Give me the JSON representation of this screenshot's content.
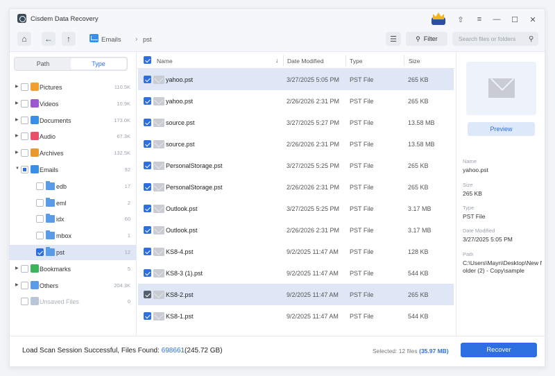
{
  "app": {
    "title": "Cisdem Data Recovery"
  },
  "colors": {
    "accent": "#2d6fe0",
    "selected_row": "#dfe7f7",
    "folder": "#5a9be8"
  },
  "titlebar": {
    "icons": [
      {
        "name": "upgrade-crown-icon"
      },
      {
        "name": "export-icon",
        "glyph": "⇧"
      },
      {
        "name": "menu-icon",
        "glyph": "≡"
      },
      {
        "name": "minimize-icon",
        "glyph": "—"
      },
      {
        "name": "maximize-icon",
        "glyph": "☐"
      },
      {
        "name": "close-icon",
        "glyph": "✕"
      }
    ]
  },
  "toolbar": {
    "home_glyph": "⌂",
    "back_glyph": "←",
    "up_glyph": "↑",
    "breadcrumb": [
      "Emails",
      "pst"
    ],
    "breadcrumb_sep": "›",
    "view_glyph": "☰",
    "filter_label": "Filter",
    "filter_glyph": "⚲",
    "search_placeholder": "Search files or folders",
    "search_glyph": "⚲"
  },
  "sidebar": {
    "tabs": [
      "Path",
      "Type"
    ],
    "active_tab": "Type",
    "items": [
      {
        "label": "Pictures",
        "count": "110.5K",
        "icon_color": "#f0a030",
        "expandable": true
      },
      {
        "label": "Videos",
        "count": "10.9K",
        "icon_color": "#9b59d0",
        "expandable": true
      },
      {
        "label": "Documents",
        "count": "173.0K",
        "icon_color": "#3a8ee6",
        "expandable": true
      },
      {
        "label": "Audio",
        "count": "67.3K",
        "icon_color": "#e8506a",
        "expandable": true
      },
      {
        "label": "Archives",
        "count": "132.5K",
        "icon_color": "#e89a30",
        "expandable": true
      },
      {
        "label": "Emails",
        "count": "92",
        "icon_color": "#3a8ee6",
        "expandable": true,
        "expanded": true
      },
      {
        "label": "edb",
        "count": "17",
        "folder": true
      },
      {
        "label": "eml",
        "count": "2",
        "folder": true
      },
      {
        "label": "idx",
        "count": "60",
        "folder": true
      },
      {
        "label": "mbox",
        "count": "1",
        "folder": true
      },
      {
        "label": "pst",
        "count": "12",
        "folder": true,
        "selected": true
      },
      {
        "label": "Bookmarks",
        "count": "5",
        "icon_color": "#3cb55a",
        "expandable": true
      },
      {
        "label": "Others",
        "count": "204.3K",
        "icon_color": "#5a9be8",
        "expandable": true
      },
      {
        "label": "Unsaved Files",
        "count": "0",
        "icon_color": "#b8c6da",
        "disabled": true
      }
    ]
  },
  "file_list": {
    "columns": [
      "Name",
      "Date Modified",
      "Type",
      "Size"
    ],
    "sort_glyph": "↓",
    "rows": [
      {
        "name": "yahoo.pst",
        "date": "3/27/2025 5:05 PM",
        "type": "PST File",
        "size": "265 KB",
        "highlight": true
      },
      {
        "name": "yahoo.pst",
        "date": "2/26/2026 2:31 PM",
        "type": "PST File",
        "size": "265 KB"
      },
      {
        "name": "source.pst",
        "date": "3/27/2025 5:27 PM",
        "type": "PST File",
        "size": "13.58 MB"
      },
      {
        "name": "source.pst",
        "date": "2/26/2026 2:31 PM",
        "type": "PST File",
        "size": "13.58 MB"
      },
      {
        "name": "PersonalStorage.pst",
        "date": "3/27/2025 5:25 PM",
        "type": "PST File",
        "size": "265 KB"
      },
      {
        "name": "PersonalStorage.pst",
        "date": "2/26/2026 2:31 PM",
        "type": "PST File",
        "size": "265 KB"
      },
      {
        "name": "Outlook.pst",
        "date": "3/27/2025 5:25 PM",
        "type": "PST File",
        "size": "3.17 MB"
      },
      {
        "name": "Outlook.pst",
        "date": "2/26/2026 2:31 PM",
        "type": "PST File",
        "size": "3.17 MB"
      },
      {
        "name": "KS8-4.pst",
        "date": "9/2/2025 11:47 AM",
        "type": "PST File",
        "size": "128 KB"
      },
      {
        "name": "KS8-3 (1).pst",
        "date": "9/2/2025 11:47 AM",
        "type": "PST File",
        "size": "544 KB"
      },
      {
        "name": "KS8-2.pst",
        "date": "9/2/2025 11:47 AM",
        "type": "PST File",
        "size": "265 KB",
        "highlight": true,
        "hover": true
      },
      {
        "name": "KS8-1.pst",
        "date": "9/2/2025 11:47 AM",
        "type": "PST File",
        "size": "544 KB"
      }
    ]
  },
  "details": {
    "preview_label": "Preview",
    "fields": [
      {
        "label": "Name",
        "value": "yahoo.pst"
      },
      {
        "label": "Size",
        "value": "265 KB"
      },
      {
        "label": "Type",
        "value": "PST File"
      },
      {
        "label": "Date Modified",
        "value": "3/27/2025 5:05 PM"
      },
      {
        "label": "Path",
        "value": "C:\\Users\\Mayn\\Desktop\\New folder (2) - Copy\\sample"
      }
    ]
  },
  "status": {
    "prefix": "Load Scan Session Successful, Files Found: ",
    "files_found": "698661",
    "total_size": "(245.72 GB)",
    "selected_prefix": "Selected: 12 files ",
    "selected_size": "(35.97 MB)",
    "recover_label": "Recover"
  }
}
